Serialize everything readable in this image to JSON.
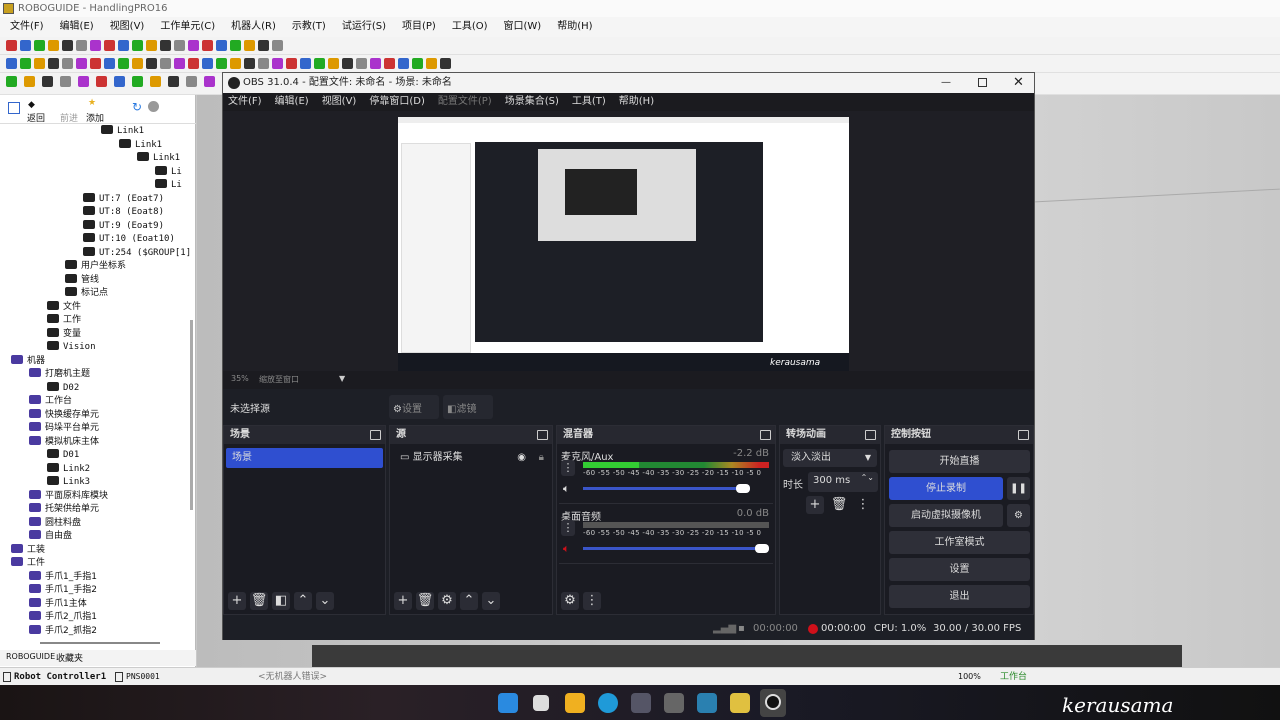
{
  "roboguide": {
    "title": "ROBOGUIDE - HandlingPRO16",
    "menu": [
      "文件(F)",
      "编辑(E)",
      "视图(V)",
      "工作单元(C)",
      "机器人(R)",
      "示教(T)",
      "试运行(S)",
      "项目(P)",
      "工具(O)",
      "窗口(W)",
      "帮助(H)"
    ],
    "nav": {
      "back": "返回",
      "forward": "前进",
      "add": "添加"
    },
    "tree": [
      {
        "label": "Link1",
        "depth": 6
      },
      {
        "label": "Link1",
        "depth": 7
      },
      {
        "label": "Link1",
        "depth": 8
      },
      {
        "label": "Li",
        "depth": 9
      },
      {
        "label": "Li",
        "depth": 9
      },
      {
        "label": "UT:7  (Eoat7)",
        "depth": 5
      },
      {
        "label": "UT:8  (Eoat8)",
        "depth": 5
      },
      {
        "label": "UT:9  (Eoat9)",
        "depth": 5
      },
      {
        "label": "UT:10  (Eoat10)",
        "depth": 5
      },
      {
        "label": "UT:254  ($GROUP[1]",
        "depth": 5
      },
      {
        "label": "用户坐标系",
        "depth": 4
      },
      {
        "label": "管线",
        "depth": 4
      },
      {
        "label": "标记点",
        "depth": 4
      },
      {
        "label": "文件",
        "depth": 3
      },
      {
        "label": "工作",
        "depth": 3
      },
      {
        "label": "变量",
        "depth": 3
      },
      {
        "label": "Vision",
        "depth": 3
      },
      {
        "label": "机器",
        "depth": 1
      },
      {
        "label": "打磨机主题",
        "depth": 2
      },
      {
        "label": "D02",
        "depth": 3
      },
      {
        "label": "工作台",
        "depth": 2
      },
      {
        "label": "快换缓存单元",
        "depth": 2
      },
      {
        "label": "码垛平台单元",
        "depth": 2
      },
      {
        "label": "模拟机床主体",
        "depth": 2
      },
      {
        "label": "D01",
        "depth": 3
      },
      {
        "label": "Link2",
        "depth": 3
      },
      {
        "label": "Link3",
        "depth": 3
      },
      {
        "label": "平面原料库模块",
        "depth": 2
      },
      {
        "label": "托架供给单元",
        "depth": 2
      },
      {
        "label": "圆柱料盘",
        "depth": 2
      },
      {
        "label": "自由盘",
        "depth": 2
      },
      {
        "label": "工装",
        "depth": 1
      },
      {
        "label": "工件",
        "depth": 1
      },
      {
        "label": "手爪1_手指1",
        "depth": 2
      },
      {
        "label": "手爪1_手指2",
        "depth": 2
      },
      {
        "label": "手爪1主体",
        "depth": 2
      },
      {
        "label": "手爪2_爪指1",
        "depth": 2
      },
      {
        "label": "手爪2_抓指2",
        "depth": 2
      }
    ],
    "tabs": [
      "ROBOGUIDE",
      "收藏夹"
    ],
    "status": {
      "controller": "Robot Controller1",
      "program": "PNS0001",
      "message": "<无机器人错误>",
      "zoom": "100%",
      "mode": "工作台"
    }
  },
  "obs": {
    "title": "OBS 31.0.4 - 配置文件: 未命名 - 场景: 未命名",
    "menu": [
      {
        "label": "文件(F)"
      },
      {
        "label": "编辑(E)"
      },
      {
        "label": "视图(V)"
      },
      {
        "label": "停靠窗口(D)"
      },
      {
        "label": "配置文件(P)",
        "disabled": true
      },
      {
        "label": "场景集合(S)"
      },
      {
        "label": "工具(T)"
      },
      {
        "label": "帮助(H)"
      }
    ],
    "zoom": "35%",
    "zoom_mode": "缩放至窗口",
    "no_source": "未选择源",
    "settings_btn": "设置",
    "filters_btn": "滤镜",
    "scenes": {
      "title": "场景",
      "items": [
        "场景"
      ]
    },
    "sources": {
      "title": "源",
      "items": [
        "显示器采集"
      ]
    },
    "mixer": {
      "title": "混音器",
      "ticks": "-60 -55 -50 -45 -40 -35 -30 -25 -20 -15 -10 -5 0",
      "channels": [
        {
          "name": "麦克风/Aux",
          "db": "-2.2 dB",
          "volume": 0.9,
          "muted": false
        },
        {
          "name": "桌面音频",
          "db": "0.0 dB",
          "volume": 1.0,
          "muted": true
        }
      ]
    },
    "transitions": {
      "title": "转场动画",
      "type": "淡入淡出",
      "duration_label": "时长",
      "duration": "300 ms"
    },
    "controls": {
      "title": "控制按钮",
      "start_stream": "开始直播",
      "stop_record": "停止录制",
      "virtual_cam": "启动虚拟摄像机",
      "studio_mode": "工作室模式",
      "settings": "设置",
      "exit": "退出"
    },
    "status": {
      "stream_time": "00:00:00",
      "rec_time": "00:00:00",
      "cpu": "CPU: 1.0%",
      "fps": "30.00 / 30.00 FPS"
    },
    "accent": "#2f4fd0",
    "rec_color": "#d0101a"
  },
  "watermark": "kerausama"
}
